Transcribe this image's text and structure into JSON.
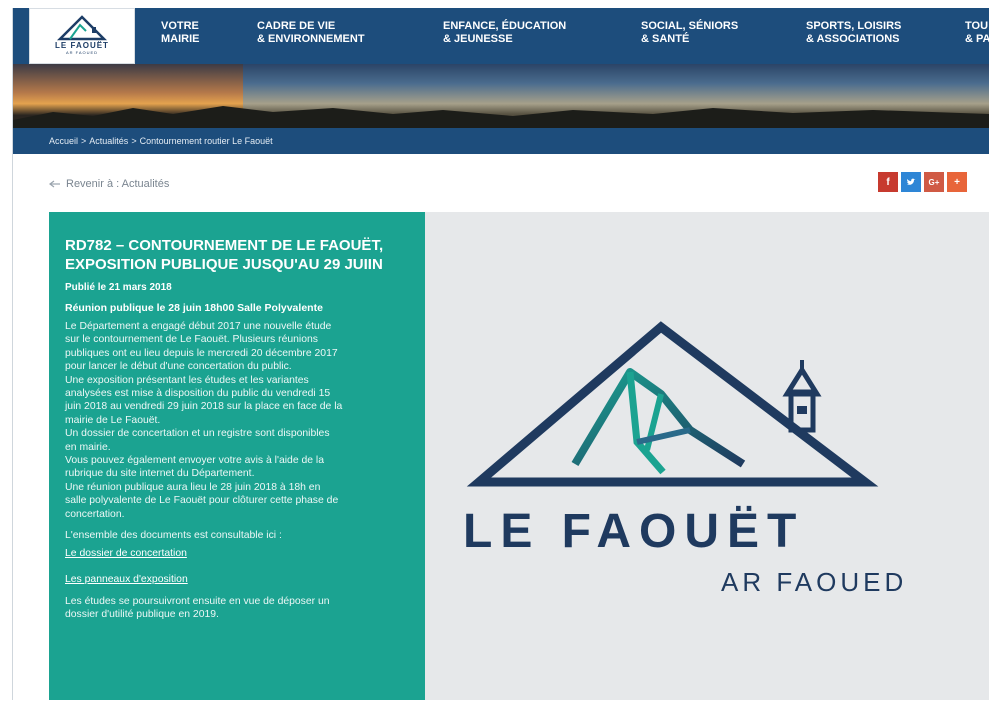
{
  "header": {
    "logo_title": "LE FAOUËT",
    "logo_sub": "AR FAOUED",
    "nav": [
      {
        "line1": "VOTRE",
        "line2": "MAIRIE"
      },
      {
        "line1": "CADRE DE VIE",
        "line2": "& ENVIRONNEMENT"
      },
      {
        "line1": "ENFANCE, ÉDUCATION",
        "line2": "& JEUNESSE"
      },
      {
        "line1": "SOCIAL, SÉNIORS",
        "line2": "& SANTÉ"
      },
      {
        "line1": "SPORTS, LOISIRS",
        "line2": "& ASSOCIATIONS"
      },
      {
        "line1": "TOU",
        "line2": "& PA"
      }
    ]
  },
  "breadcrumb": {
    "home": "Accueil",
    "section": "Actualités",
    "current": "Contournement routier Le Faouët",
    "separator": ">"
  },
  "back_link": "Revenir à : Actualités",
  "share": {
    "facebook": "f",
    "twitter": "t",
    "googleplus": "G+",
    "more": "+"
  },
  "article": {
    "title_line1": "RD782 – CONTOURNEMENT DE LE FAOUËT,",
    "title_line2": "EXPOSITION PUBLIQUE JUSQU'AU 29 JUIIN",
    "published": "Publié le 21 mars 2018",
    "meeting": "Réunion publique le 28 juin 18h00 Salle Polyvalente",
    "body_lines": [
      "Le Département a engagé début 2017 une nouvelle étude",
      "sur le contournement de Le Faouët. Plusieurs réunions",
      "publiques ont eu lieu depuis le mercredi 20 décembre 2017",
      "pour lancer le début d'une concertation du public.",
      "Une exposition présentant les études et les variantes",
      "analysées est mise à disposition du public du vendredi 15",
      "juin 2018 au vendredi 29 juin 2018 sur la place en face de la",
      "mairie de Le Faouët.",
      "Un dossier de concertation et un registre sont disponibles",
      "en mairie.",
      "Vous pouvez également envoyer votre avis à l'aide de la",
      "rubrique du site internet du Département.",
      "Une réunion publique aura lieu le 28 juin 2018 à 18h en",
      "salle polyvalente de Le Faouët pour clôturer cette phase de",
      "concertation."
    ],
    "docs_intro": "L'ensemble des documents est consultable ici :",
    "link_dossier": "Le dossier de concertation",
    "link_panneaux": "Les panneaux d'exposition",
    "closing_lines": [
      "Les études se poursuivront ensuite en vue de déposer un",
      "dossier d'utilité publique en 2019."
    ]
  },
  "illustration": {
    "title": "LE FAOUËT",
    "subtitle": "AR FAOUED"
  },
  "colors": {
    "navy": "#1d4d7c",
    "teal": "#1ba391",
    "logo_blue": "#1f3a5f"
  }
}
